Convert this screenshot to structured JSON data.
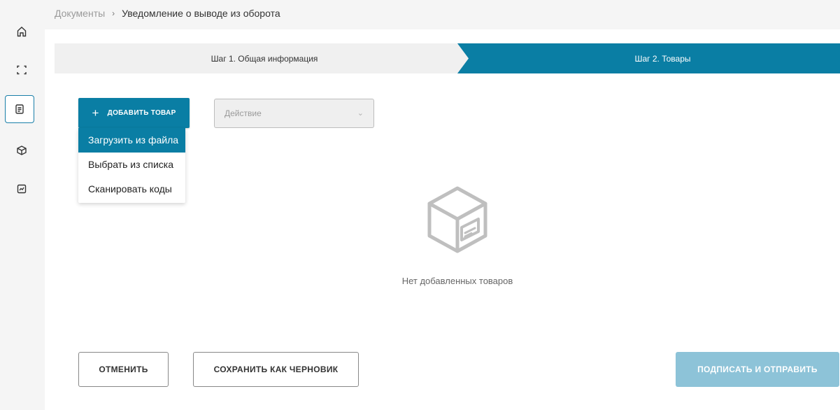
{
  "sidebar": {
    "items": [
      {
        "icon": "home-icon",
        "active": false
      },
      {
        "icon": "scan-icon",
        "active": false
      },
      {
        "icon": "document-icon",
        "active": true
      },
      {
        "icon": "box-icon",
        "active": false
      },
      {
        "icon": "chart-icon",
        "active": false
      }
    ]
  },
  "breadcrumb": {
    "root": "Документы",
    "separator": "›",
    "current": "Уведомление о выводе из оборота"
  },
  "steps": {
    "step1": "Шаг 1. Общая информация",
    "step2": "Шаг 2. Товары"
  },
  "toolbar": {
    "add_label": "ДОБАВИТЬ ТОВАР",
    "add_icon": "+",
    "action_placeholder": "Действие",
    "action_chevron": "⌄"
  },
  "add_menu": {
    "items": [
      {
        "label": "Загрузить из файла",
        "selected": true
      },
      {
        "label": "Выбрать из списка",
        "selected": false
      },
      {
        "label": "Сканировать коды",
        "selected": false
      }
    ]
  },
  "empty_state": {
    "icon": "empty-box-icon",
    "text": "Нет добавленных товаров"
  },
  "footer": {
    "cancel_label": "ОТМЕНИТЬ",
    "draft_label": "СОХРАНИТЬ КАК ЧЕРНОВИК",
    "submit_label": "ПОДПИСАТЬ И ОТПРАВИТЬ"
  },
  "colors": {
    "accent": "#0a7ea4",
    "submit_disabled": "#8dc3d8"
  }
}
